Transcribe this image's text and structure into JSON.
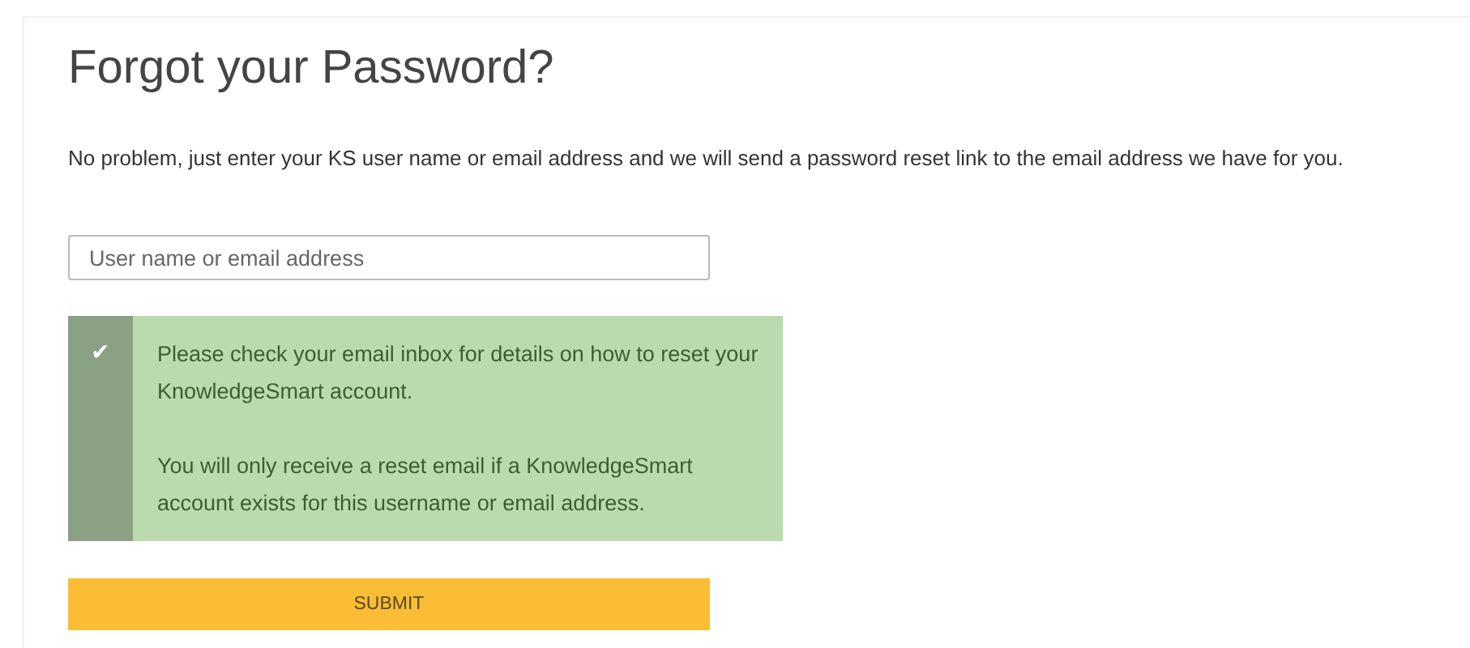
{
  "title": "Forgot your Password?",
  "intro": "No problem, just enter your KS user name or email address and we will send a password reset link to the email address we have for you.",
  "username_field": {
    "placeholder": "User name or email address"
  },
  "alert": {
    "kind": "success",
    "icon": "✔",
    "messages": [
      "Please check your email inbox for details on how to reset your KnowledgeSmart account.",
      "You will only receive a reset email if a KnowledgeSmart account exists for this username or email address."
    ]
  },
  "submit_button": {
    "label": "SUBMIT"
  }
}
